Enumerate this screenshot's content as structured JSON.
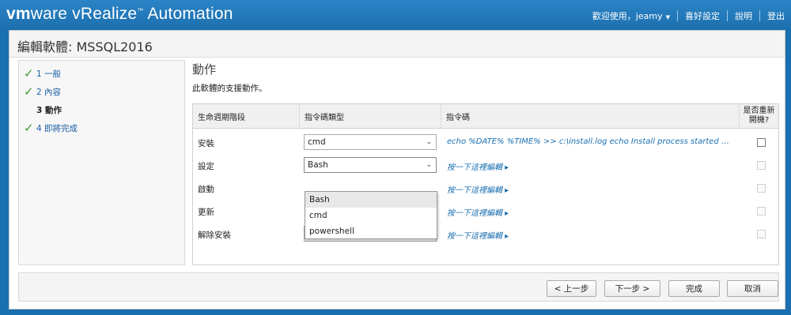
{
  "header": {
    "brand_vm": "vm",
    "brand_ware": "ware",
    "brand_product": " vRealize",
    "brand_tm": "™",
    "brand_suffix": " Automation",
    "welcome": "歡迎使用，jeamy",
    "preferences": "喜好設定",
    "help": "說明",
    "logout": "登出"
  },
  "page": {
    "title": "編輯軟體: MSSQL2016"
  },
  "steps": [
    {
      "label": "1 一般",
      "done": true
    },
    {
      "label": "2 內容",
      "done": true
    },
    {
      "label": "3 動作",
      "done": false,
      "current": true
    },
    {
      "label": "4 即將完成",
      "done": true
    }
  ],
  "section": {
    "title": "動作",
    "description": "此軟體的支援動作。"
  },
  "grid": {
    "headers": [
      "生命週期階段",
      "指令碼類型",
      "指令碼",
      "是否重新開機?"
    ],
    "rows": [
      {
        "lifecycle": "安裝",
        "script_type": "cmd",
        "script": "echo %DATE% %TIME% >> c:\\install.log echo Install process started >> c:\\install.log",
        "is_link": false,
        "reboot_enabled": true
      },
      {
        "lifecycle": "設定",
        "script_type": "Bash",
        "script": "按一下這裡編輯 ▸",
        "is_link": true,
        "reboot_enabled": false
      },
      {
        "lifecycle": "啟動",
        "script_type": "",
        "script": "按一下這裡編輯 ▸",
        "is_link": true,
        "reboot_enabled": false
      },
      {
        "lifecycle": "更新",
        "script_type": "",
        "script": "按一下這裡編輯 ▸",
        "is_link": true,
        "reboot_enabled": false
      },
      {
        "lifecycle": "解除安裝",
        "script_type": "Bash",
        "script": "按一下這裡編輯 ▸",
        "is_link": true,
        "reboot_enabled": false
      }
    ],
    "dropdown_options": [
      "Bash",
      "cmd",
      "powershell"
    ]
  },
  "footer": {
    "prev": "< 上一步",
    "next": "下一步 >",
    "finish": "完成",
    "cancel": "取消"
  },
  "colors": {
    "header_bg": "#1d6fae",
    "link": "#1a6fb0",
    "check": "#3f9b35"
  }
}
